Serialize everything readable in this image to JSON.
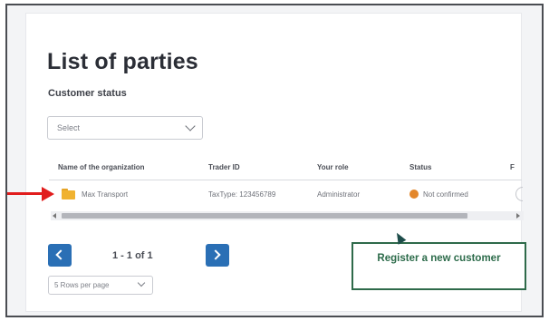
{
  "page": {
    "title": "List of parties",
    "filter_label": "Customer status",
    "filter_value": "Select"
  },
  "table": {
    "columns": [
      "Name of the organization",
      "Trader ID",
      "Your role",
      "Status",
      "F"
    ],
    "rows": [
      {
        "name": "Max Transport",
        "trader_id": "TaxType: 123456789",
        "role": "Administrator",
        "status": "Not confirmed"
      }
    ]
  },
  "pagination": {
    "range_text": "1 - 1 of 1",
    "rows_per_page": "5 Rows per page"
  },
  "actions": {
    "register_label": "Register a new customer"
  },
  "colors": {
    "primary_blue": "#2a6fb5",
    "register_green": "#2e6a4a",
    "status_orange": "#e3872b",
    "annotation_red": "#e11d1d",
    "folder_yellow": "#f0b230"
  },
  "icons": {
    "row_icon": "folder-icon",
    "status_icon": "status-dot-icon",
    "prev": "chevron-left-icon",
    "next": "chevron-right-icon"
  }
}
